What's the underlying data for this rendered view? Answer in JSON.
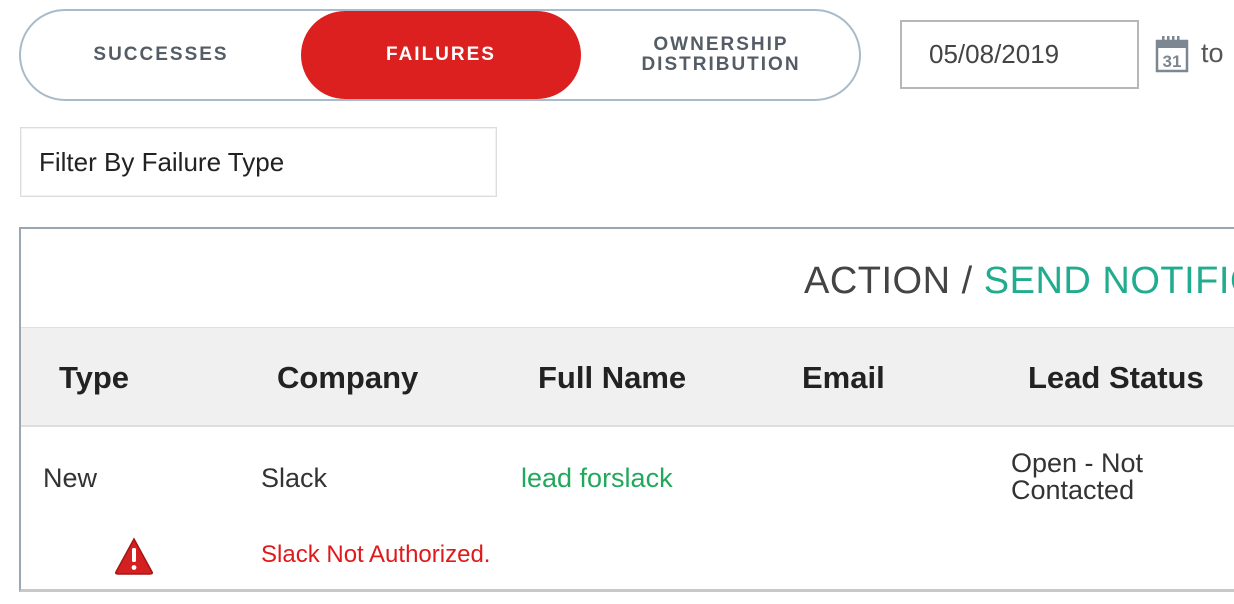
{
  "tabs": {
    "successes": "SUCCESSES",
    "failures": "FAILURES",
    "ownership_line1": "OWNERSHIP",
    "ownership_line2": "DISTRIBUTION",
    "active": "failures"
  },
  "date_range": {
    "start_value": "05/08/2019",
    "calendar_icon": "calendar-icon",
    "calendar_day": "31",
    "to_label": "to"
  },
  "filter": {
    "label": "Filter By Failure Type"
  },
  "panel": {
    "title_action": "ACTION",
    "title_separator": " / ",
    "title_send": "SEND NOTIFICA",
    "columns": [
      "Type",
      "Company",
      "Full Name",
      "Email",
      "Lead Status"
    ],
    "rows": [
      {
        "type": "New",
        "company": "Slack",
        "full_name": "lead forslack",
        "email": "",
        "lead_status_line1": "Open - Not",
        "lead_status_line2": "Contacted",
        "warning_icon": "warning-icon",
        "error": "Slack Not Authorized."
      }
    ]
  },
  "colors": {
    "accent_red": "#dc1f1f",
    "link_green": "#22a85c",
    "title_teal": "#20ac8f",
    "error_red": "#e01a1a"
  }
}
